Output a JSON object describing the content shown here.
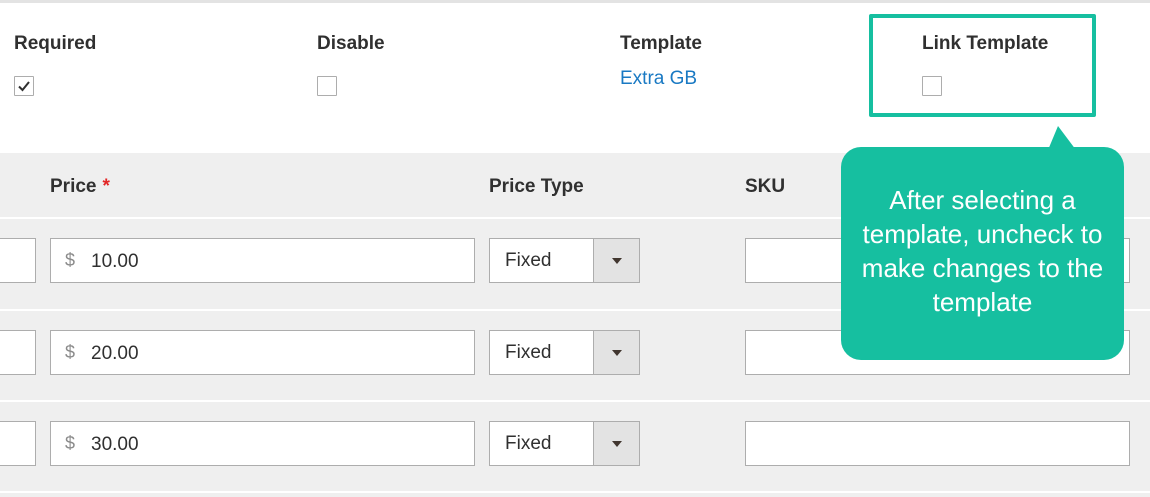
{
  "options_header": {
    "required_label": "Required",
    "required_checked": true,
    "disable_label": "Disable",
    "disable_checked": false,
    "template_label": "Template",
    "template_value": "Extra GB",
    "link_template_label": "Link Template",
    "link_template_checked": false
  },
  "grid": {
    "columns": {
      "price": "Price",
      "price_required_mark": "*",
      "price_type": "Price Type",
      "sku": "SKU"
    },
    "rows": [
      {
        "currency": "$",
        "price": "10.00",
        "price_type": "Fixed",
        "sku": ""
      },
      {
        "currency": "$",
        "price": "20.00",
        "price_type": "Fixed",
        "sku": ""
      },
      {
        "currency": "$",
        "price": "30.00",
        "price_type": "Fixed",
        "sku": ""
      }
    ]
  },
  "tooltip": {
    "text": "After selecting a template, uncheck to make changes to the template"
  },
  "colors": {
    "accent_teal": "#16bfa0",
    "link_blue": "#1979c3",
    "required_red": "#e22626"
  },
  "icons": [
    "checkmark-icon",
    "chevron-down-icon"
  ]
}
